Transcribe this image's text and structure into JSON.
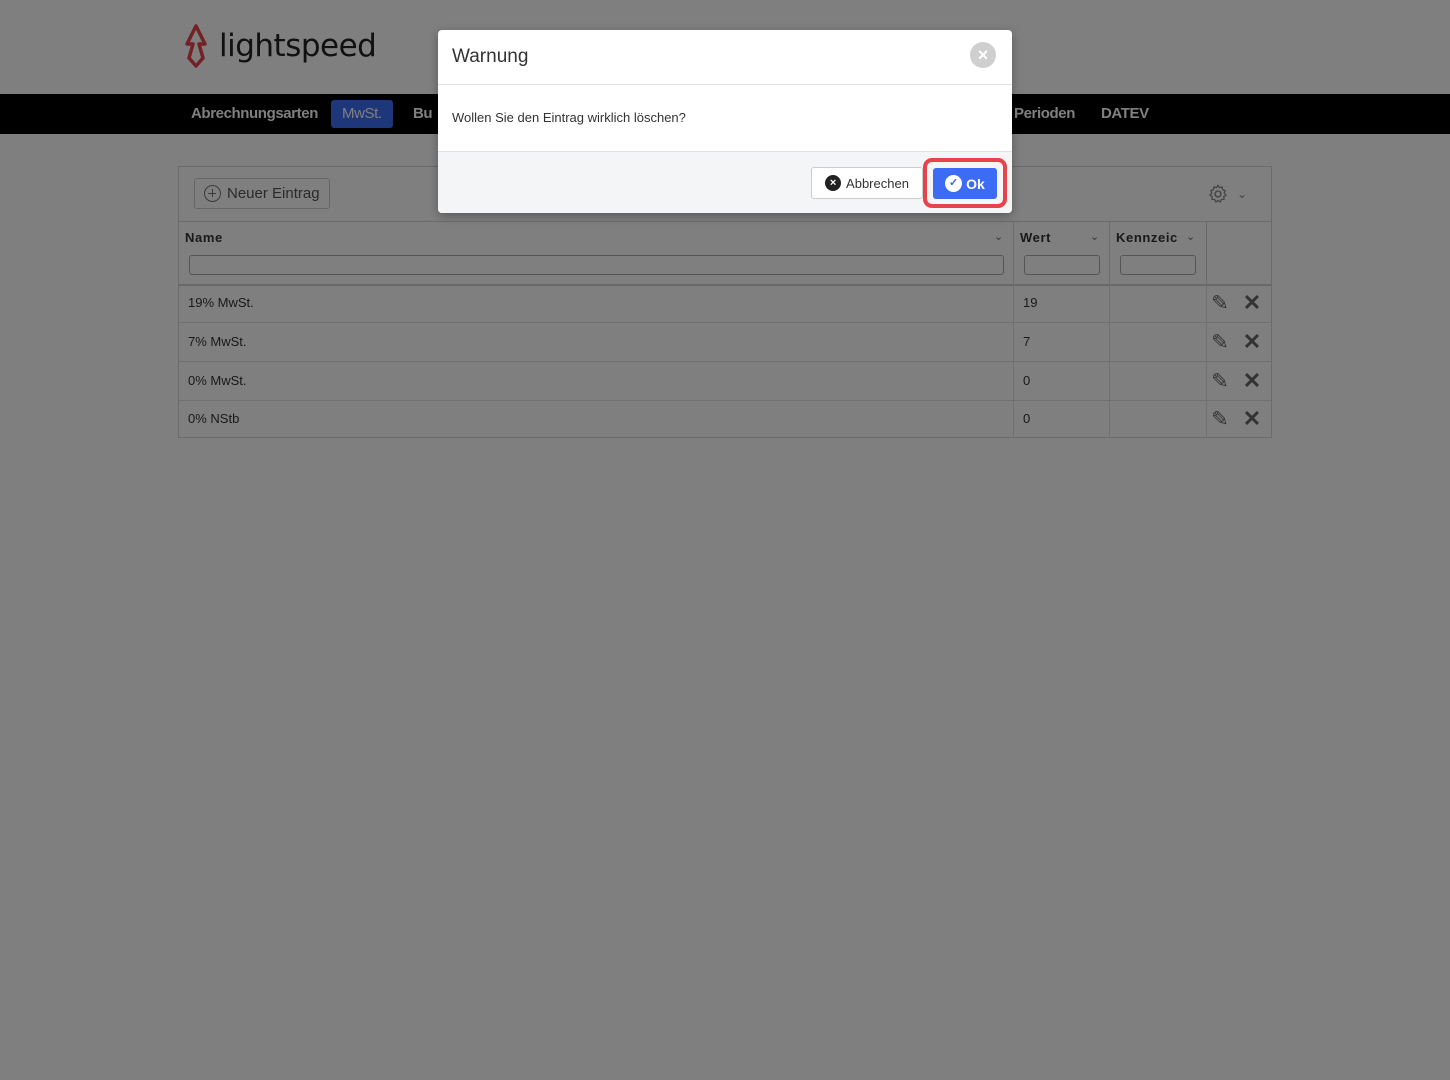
{
  "brand": {
    "name": "lightspeed"
  },
  "nav": {
    "items": [
      {
        "label": "Abrechnungsarten",
        "active": false
      },
      {
        "label": "MwSt.",
        "active": true
      },
      {
        "label": "Bu",
        "active": false
      },
      {
        "label": "Perioden",
        "active": false
      },
      {
        "label": "DATEV",
        "active": false
      }
    ]
  },
  "toolbar": {
    "new_entry_label": "Neuer Eintrag",
    "settings_icon": "gear-icon"
  },
  "table": {
    "columns": [
      {
        "label": "Name"
      },
      {
        "label": "Wert"
      },
      {
        "label": "Kennzeic"
      }
    ],
    "rows": [
      {
        "name": "19% MwSt.",
        "wert": "19",
        "kennzeichen": ""
      },
      {
        "name": "7% MwSt.",
        "wert": "7",
        "kennzeichen": ""
      },
      {
        "name": "0% MwSt.",
        "wert": "0",
        "kennzeichen": ""
      },
      {
        "name": "0% NStb",
        "wert": "0",
        "kennzeichen": ""
      }
    ]
  },
  "dialog": {
    "title": "Warnung",
    "message": "Wollen Sie den Eintrag wirklich löschen?",
    "cancel_label": "Abbrechen",
    "ok_label": "Ok"
  },
  "colors": {
    "accent": "#3c6cf5",
    "brand_red": "#e8424b",
    "navbar": "#000000"
  }
}
